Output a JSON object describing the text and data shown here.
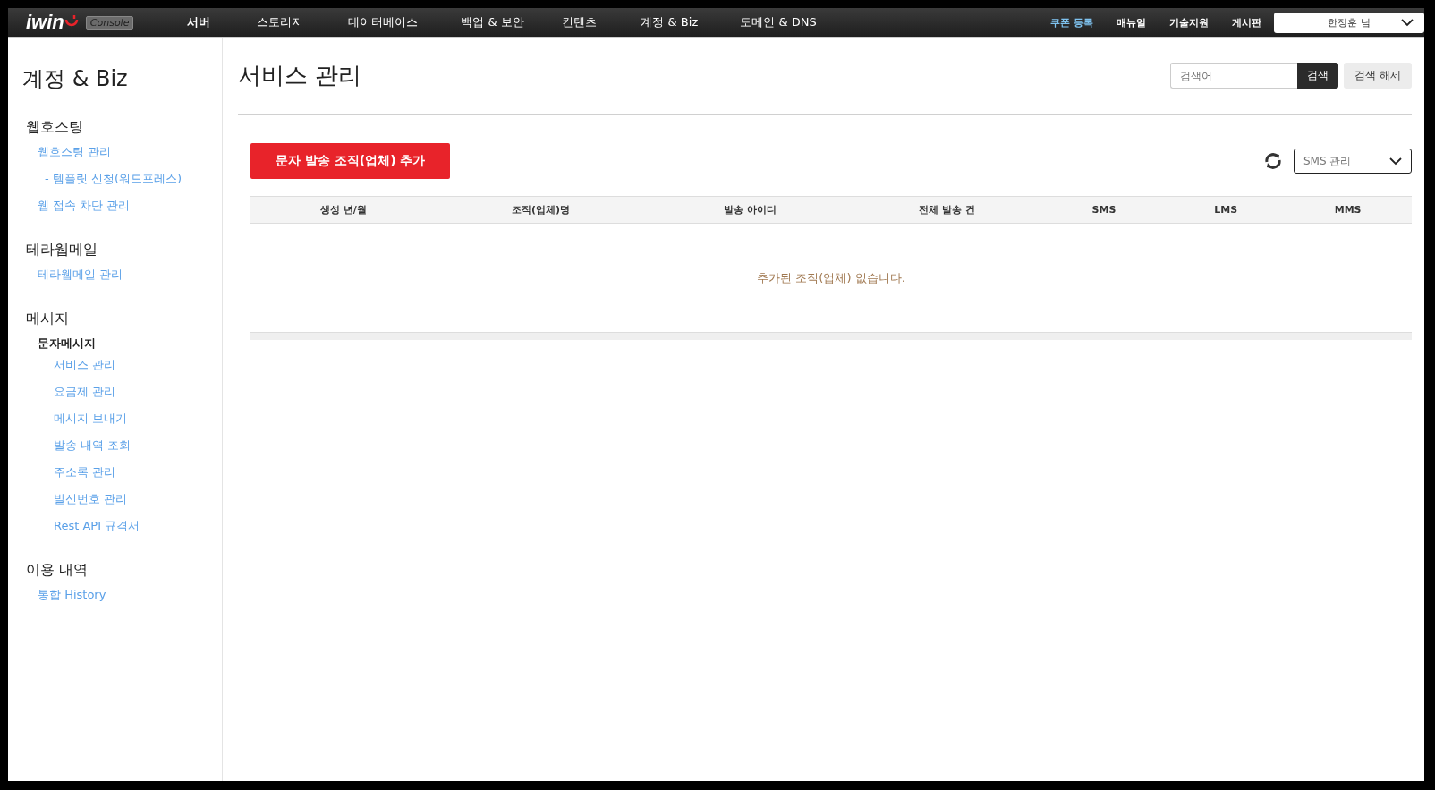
{
  "header": {
    "logo": "iwin",
    "logo_badge": "Console",
    "nav": [
      {
        "label": "서버",
        "selected": true
      },
      {
        "label": "스토리지",
        "selected": false
      },
      {
        "label": "데이터베이스",
        "selected": false
      },
      {
        "label": "백업 & 보안",
        "selected": false
      },
      {
        "label": "컨텐츠",
        "selected": false
      },
      {
        "label": "계정 & Biz",
        "selected": false
      },
      {
        "label": "도메인 & DNS",
        "selected": false
      }
    ],
    "links": [
      {
        "label": "쿠폰 등록",
        "highlighted": true
      },
      {
        "label": "매뉴얼",
        "highlighted": false
      },
      {
        "label": "기술지원",
        "highlighted": false
      },
      {
        "label": "게시판",
        "highlighted": false
      }
    ],
    "user": "한정훈 님"
  },
  "sidebar": {
    "title": "계정 & Biz",
    "groups": [
      {
        "title": "웹호스팅",
        "items": [
          {
            "label": "웹호스팅 관리",
            "children": [
              {
                "label": "- 템플릿 신청(워드프레스)"
              }
            ]
          },
          {
            "label": "웹 접속 차단 관리"
          }
        ]
      },
      {
        "title": "테라웹메일",
        "items": [
          {
            "label": "테라웹메일 관리"
          }
        ]
      },
      {
        "title": "메시지",
        "subgroups": [
          {
            "title": "문자메시지",
            "items": [
              {
                "label": "서비스 관리"
              },
              {
                "label": "요금제 관리"
              },
              {
                "label": "메시지 보내기"
              },
              {
                "label": "발송 내역 조회"
              },
              {
                "label": "주소록 관리"
              },
              {
                "label": "발신번호 관리"
              },
              {
                "label": "Rest API 규격서"
              }
            ]
          }
        ]
      },
      {
        "title": "이용 내역",
        "items": [
          {
            "label": "통합 History"
          }
        ]
      }
    ]
  },
  "main": {
    "title": "서비스 관리",
    "search": {
      "placeholder": "검색어",
      "button": "검색",
      "clear": "검색 해제"
    },
    "add_button": "문자 발송 조직(업체) 추가",
    "select": "SMS 관리",
    "table": {
      "columns": [
        "생성 년/월",
        "조직(업체)명",
        "발송 아이디",
        "전체 발송 건",
        "SMS",
        "LMS",
        "MMS"
      ],
      "empty": "추가된 조직(업체) 없습니다."
    }
  }
}
